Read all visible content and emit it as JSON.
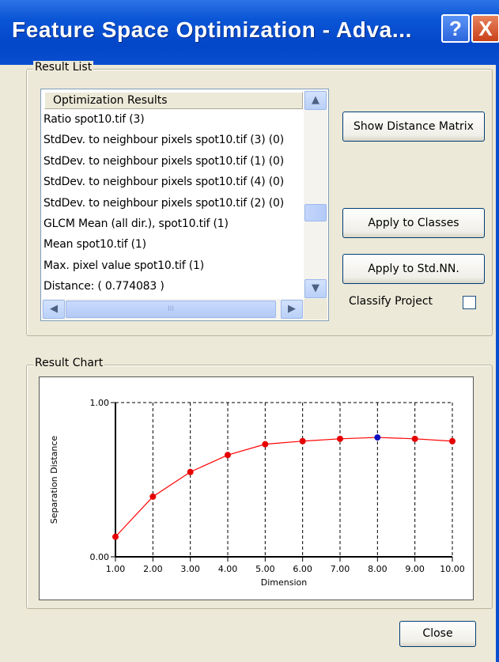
{
  "window": {
    "title": "Feature Space Optimization - Adva...",
    "help_glyph": "?",
    "close_glyph": "X"
  },
  "result_list": {
    "group_label": "Result List",
    "header": "Optimization Results",
    "items": [
      "Ratio spot10.tif (3)",
      "StdDev. to neighbour pixels spot10.tif (3)  (0)",
      "StdDev. to neighbour pixels spot10.tif (1)  (0)",
      "StdDev. to neighbour pixels spot10.tif (4)  (0)",
      "StdDev. to neighbour pixels spot10.tif (2)  (0)",
      "GLCM Mean  (all dir.), spot10.tif (1)",
      "Mean spot10.tif (1)",
      "Max. pixel value spot10.tif (1)",
      "Distance: ( 0.774083 )"
    ],
    "scroll_up": "▲",
    "scroll_down": "▼",
    "scroll_left": "◀",
    "scroll_right": "▶",
    "hthumb_grip": "III"
  },
  "buttons": {
    "show_distance_matrix": "Show Distance Matrix",
    "apply_to_classes": "Apply to Classes",
    "apply_to_std_nn": "Apply to Std.NN.",
    "close": "Close"
  },
  "classify_project": {
    "label": "Classify Project",
    "checked": false
  },
  "result_chart": {
    "group_label": "Result Chart"
  },
  "colors": {
    "line": "#ff0000",
    "point": "#e60000",
    "selected_point": "#1010c0",
    "title_bar": "#0a4fd0"
  },
  "chart_data": {
    "type": "line",
    "title": "",
    "xlabel": "Dimension",
    "ylabel": "Separation Distance",
    "xlim": [
      1,
      10
    ],
    "ylim": [
      0,
      1
    ],
    "x_ticks": [
      "1.00",
      "2.00",
      "3.00",
      "4.00",
      "5.00",
      "6.00",
      "7.00",
      "8.00",
      "9.00",
      "10.00"
    ],
    "y_ticks": [
      "0.00",
      "1.00"
    ],
    "grid": "vertical dashed at each x tick; horizontal dashed at 1.00",
    "series": [
      {
        "x": [
          1,
          2,
          3,
          4,
          5,
          6,
          7,
          8,
          9,
          10
        ],
        "values": [
          0.13,
          0.39,
          0.55,
          0.66,
          0.73,
          0.75,
          0.765,
          0.774,
          0.765,
          0.75
        ]
      }
    ],
    "selected_index": 7
  }
}
